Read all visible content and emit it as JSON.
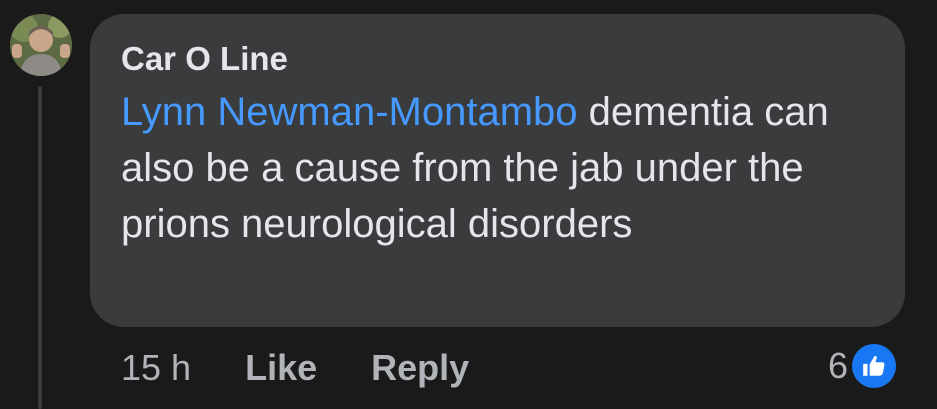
{
  "comment": {
    "author": "Car O Line",
    "mention": "Lynn Newman-Montambo",
    "text": " dementia can also be a cause from the jab under the prions neurological disorders"
  },
  "actions": {
    "time": "15 h",
    "like_label": "Like",
    "reply_label": "Reply"
  },
  "reactions": {
    "count": "6",
    "icon": "thumbs-up-icon"
  },
  "colors": {
    "background": "#1a1a1b",
    "bubble": "#3a3b3c",
    "mention": "#4599ff",
    "like_badge": "#1877f2"
  }
}
